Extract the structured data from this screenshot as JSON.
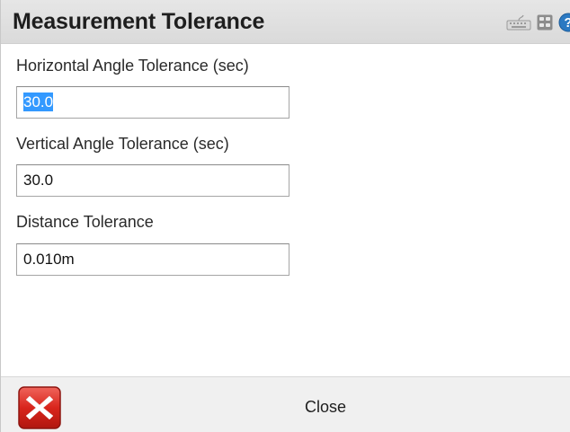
{
  "header": {
    "title": "Measurement Tolerance",
    "icons": [
      "keyboard-icon",
      "grid-icon",
      "help-icon"
    ]
  },
  "fields": [
    {
      "label": "Horizontal Angle Tolerance (sec)",
      "value": "30.0",
      "selected": true
    },
    {
      "label": "Vertical Angle Tolerance (sec)",
      "value": "30.0",
      "selected": false
    },
    {
      "label": "Distance Tolerance",
      "value": "0.010m",
      "selected": false
    }
  ],
  "footer": {
    "close_label": "Close",
    "close_icon": "close-icon"
  },
  "colors": {
    "titlebar": "#dadada",
    "selection": "#3399ff",
    "close_icon_red": "#d9251c",
    "help_blue": "#2b79c2"
  }
}
